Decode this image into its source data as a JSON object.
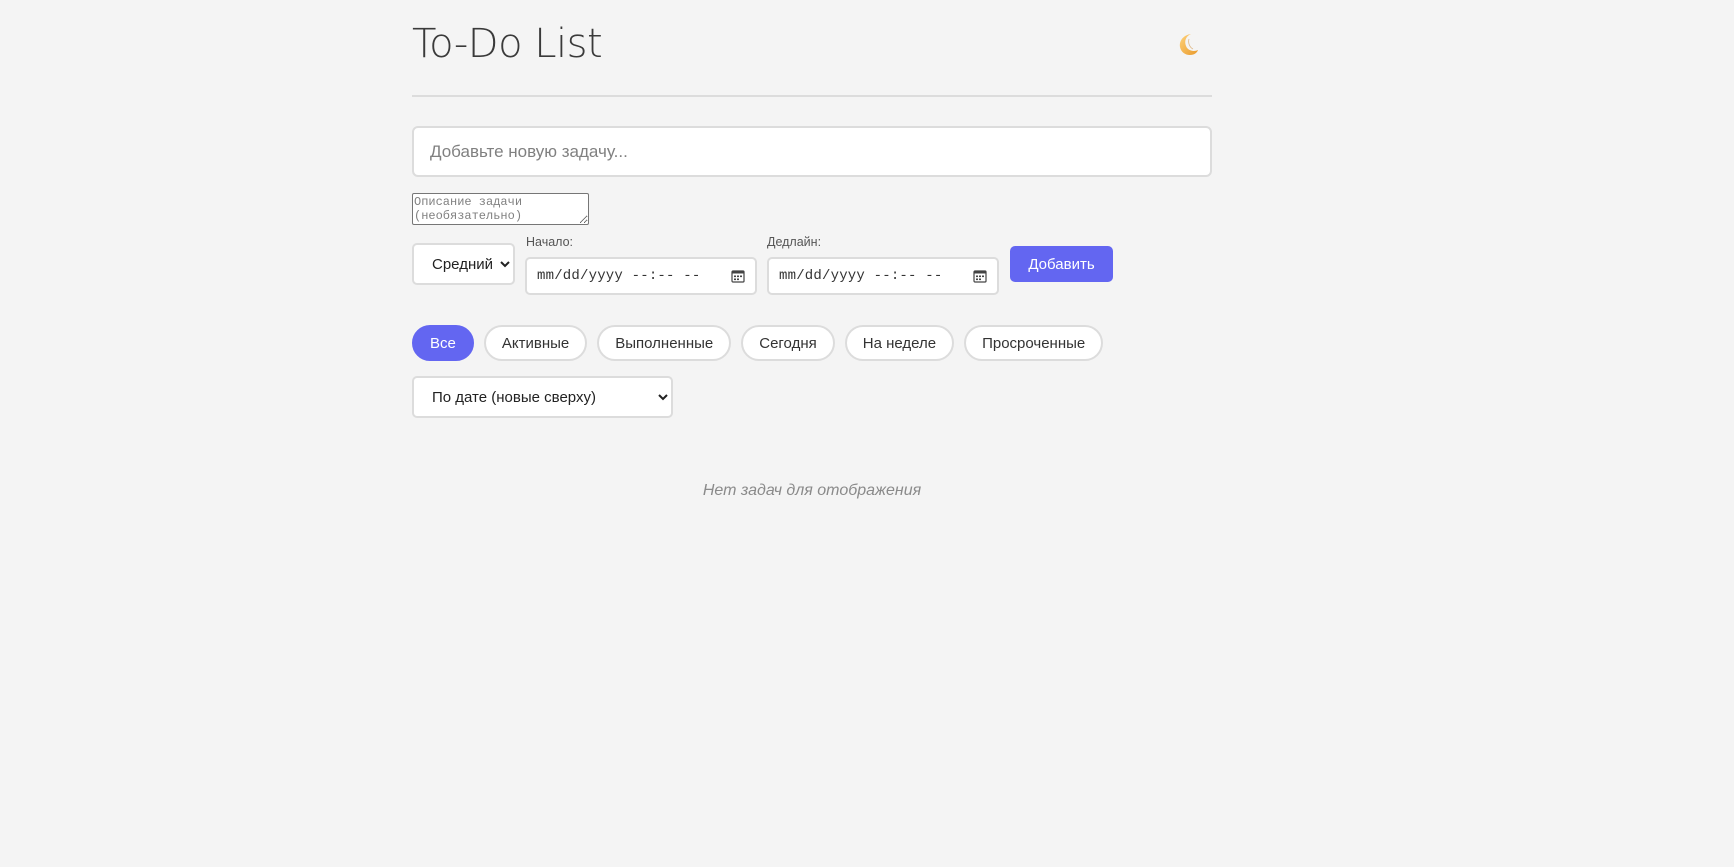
{
  "header": {
    "title": "To-Do List",
    "theme_toggle_icon": "crescent-moon-icon"
  },
  "form": {
    "task_placeholder": "Добавьте новую задачу...",
    "description_placeholder": "Описание задачи (необязательно)",
    "priority": {
      "selected": "Средний"
    },
    "start": {
      "label": "Начало:",
      "value": "mm/dd/yyyy --:-- --"
    },
    "deadline": {
      "label": "Дедлайн:",
      "value": "mm/dd/yyyy --:-- --"
    },
    "add_label": "Добавить"
  },
  "filters": [
    {
      "label": "Все",
      "active": true
    },
    {
      "label": "Активные",
      "active": false
    },
    {
      "label": "Выполненные",
      "active": false
    },
    {
      "label": "Сегодня",
      "active": false
    },
    {
      "label": "На неделе",
      "active": false
    },
    {
      "label": "Просроченные",
      "active": false
    }
  ],
  "sort": {
    "selected": "По дате (новые сверху)"
  },
  "empty_message": "Нет задач для отображения",
  "colors": {
    "accent": "#6366f1",
    "background": "#f4f4f4"
  }
}
